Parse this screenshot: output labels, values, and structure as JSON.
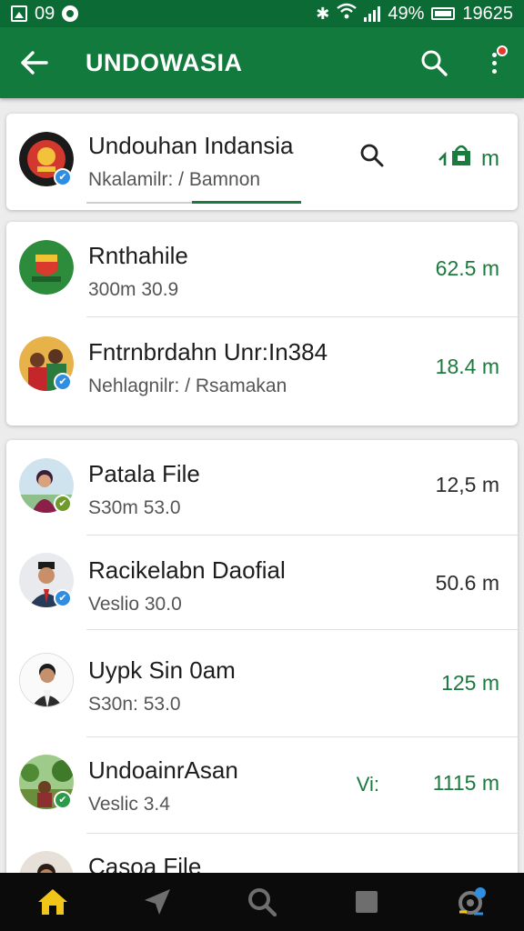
{
  "status_bar": {
    "time": "09",
    "battery": "49%",
    "clock_right": "19625",
    "icons": [
      "gallery-icon",
      "notification-icon",
      "bluetooth-icon",
      "wifi-icon",
      "signal-icon",
      "battery-icon"
    ]
  },
  "app_bar": {
    "title": "UNDOWASIA",
    "icons": [
      "back-arrow-icon",
      "search-icon",
      "more-vert-icon"
    ],
    "colors": {
      "bar": "#137a3d",
      "status": "#0c6b34",
      "notification": "#e23b2e"
    }
  },
  "header_card": {
    "title": "Undouhan Indansia",
    "subtitle": "Nkalamilr: / Bamnon",
    "size": "m",
    "icons": [
      "search-icon",
      "shopping-bag-icon"
    ]
  },
  "group1": [
    {
      "title": "Rnthahile",
      "subtitle": "300m 30.9",
      "size": "62.5 m",
      "avatar": "crest-avatar",
      "badge": ""
    },
    {
      "title": "Fntrnbrdahn Unr:In384",
      "subtitle": "Nehlagnilr: / Rsamakan",
      "size": "18.4 m",
      "avatar": "group-photo-avatar",
      "badge": "verified-icon"
    }
  ],
  "group2": [
    {
      "title": "Patala File",
      "subtitle": "S30m 53.0",
      "size": "12,5 m",
      "avatar": "woman-avatar",
      "badge": "verified-icon"
    },
    {
      "title": "Racikelabn Daofial",
      "subtitle": "Veslio 30.0",
      "size": "50.6 m",
      "avatar": "man-peci-avatar",
      "badge": "verified-icon"
    },
    {
      "title": "Uypk Sin 0am",
      "subtitle": "S30n: 53.0",
      "size": "125 m",
      "avatar": "man-suit-avatar",
      "badge": ""
    },
    {
      "title": "UndoainrAsan",
      "subtitle": "Veslic 3.4",
      "size": "1115 m",
      "extra": "Vi:",
      "avatar": "landscape-avatar",
      "badge": "check-icon"
    },
    {
      "title": "Casoa File",
      "subtitle": "",
      "size": "",
      "avatar": "man-avatar",
      "badge": ""
    }
  ],
  "bottom_nav": {
    "items": [
      "home-icon",
      "send-icon",
      "search-icon",
      "stop-icon",
      "sync-icon"
    ],
    "active_color": "#f2c618"
  }
}
